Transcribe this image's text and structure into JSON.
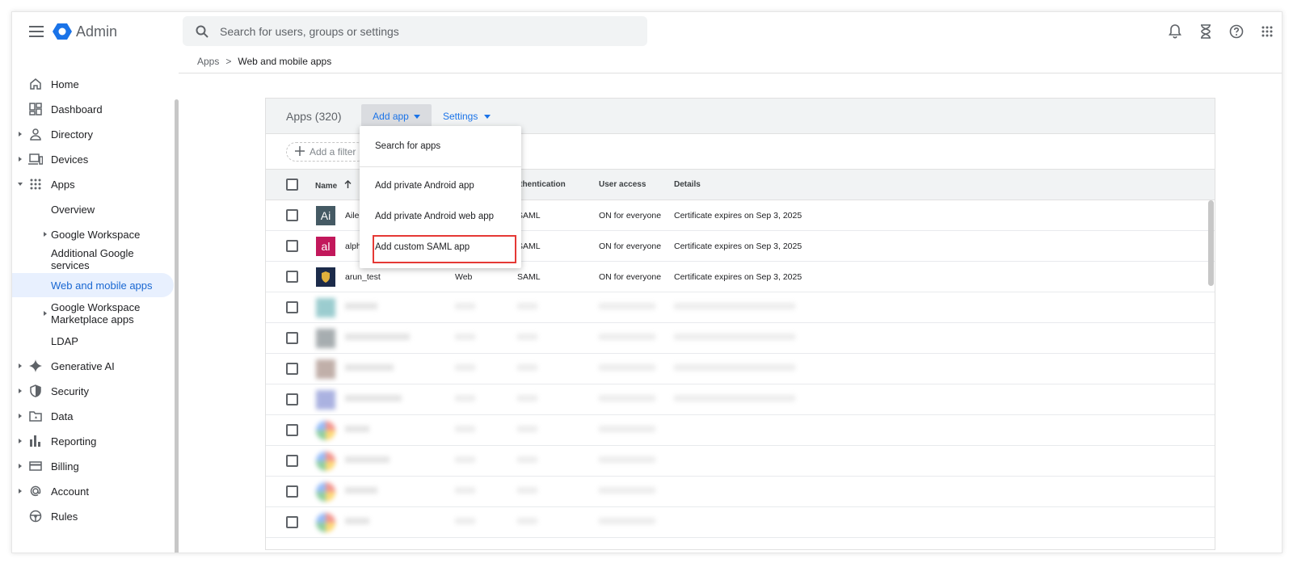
{
  "header": {
    "brand": "Admin",
    "search_placeholder": "Search for users, groups or settings"
  },
  "sidebar": {
    "items": [
      {
        "label": "Home",
        "icon": "home-icon"
      },
      {
        "label": "Dashboard",
        "icon": "dashboard-icon"
      },
      {
        "label": "Directory",
        "icon": "person-icon"
      },
      {
        "label": "Devices",
        "icon": "devices-icon"
      },
      {
        "label": "Apps",
        "icon": "apps-grid-icon"
      },
      {
        "label": "Overview"
      },
      {
        "label": "Google Workspace"
      },
      {
        "label": "Additional Google services"
      },
      {
        "label": "Web and mobile apps"
      },
      {
        "label": "Google Workspace\nMarketplace apps"
      },
      {
        "label": "LDAP"
      },
      {
        "label": "Generative AI",
        "icon": "sparkle-icon"
      },
      {
        "label": "Security",
        "icon": "shield-icon"
      },
      {
        "label": "Data",
        "icon": "folder-icon"
      },
      {
        "label": "Reporting",
        "icon": "bar-chart-icon"
      },
      {
        "label": "Billing",
        "icon": "credit-card-icon"
      },
      {
        "label": "Account",
        "icon": "at-sign-icon"
      },
      {
        "label": "Rules",
        "icon": "steering-wheel-icon"
      }
    ]
  },
  "breadcrumb": {
    "root": "Apps",
    "separator": ">",
    "current": "Web and mobile apps"
  },
  "panel": {
    "title": "Apps (320)",
    "add_app": "Add app",
    "settings": "Settings",
    "add_filter": "Add a filter"
  },
  "table": {
    "headers": {
      "name": "Name",
      "authentication": "uthentication",
      "user_access": "User access",
      "details": "Details"
    },
    "rows": [
      {
        "avatar_text": "Ai",
        "avatar_color": "#455a64",
        "name": "Ailee",
        "type": "",
        "auth": "SAML",
        "access": "ON for everyone",
        "details": "Certificate expires on Sep 3, 2025"
      },
      {
        "avatar_text": "al",
        "avatar_color": "#c2185b",
        "name": "alph",
        "type": "",
        "auth": "SAML",
        "access": "ON for everyone",
        "details": "Certificate expires on Sep 3, 2025"
      },
      {
        "avatar_text": "",
        "avatar_color": "#1c2b4a",
        "name": "arun_test",
        "type": "Web",
        "auth": "SAML",
        "access": "ON for everyone",
        "details": "Certificate expires on Sep 3, 2025"
      }
    ]
  },
  "dropdown": {
    "items": [
      "Search for apps",
      "Add private Android app",
      "Add private Android web app",
      "Add custom SAML app"
    ]
  },
  "colors": {
    "accent": "#1a73e8",
    "active_bg": "#e8f0fe",
    "highlight": "#e53935"
  }
}
